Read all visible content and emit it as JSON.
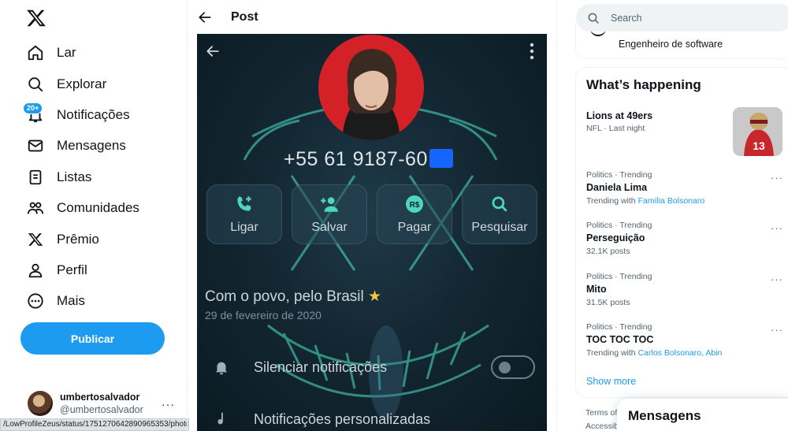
{
  "nav": {
    "items": [
      {
        "label": "Lar",
        "icon": "home-icon"
      },
      {
        "label": "Explorar",
        "icon": "search-icon"
      },
      {
        "label": "Notificações",
        "icon": "bell-icon"
      },
      {
        "label": "Mensagens",
        "icon": "envelope-icon"
      },
      {
        "label": "Listas",
        "icon": "list-icon"
      },
      {
        "label": "Comunidades",
        "icon": "communities-icon"
      },
      {
        "label": "Prêmio",
        "icon": "x-logo-icon"
      },
      {
        "label": "Perfil",
        "icon": "person-icon"
      },
      {
        "label": "Mais",
        "icon": "more-circle-icon"
      }
    ],
    "notification_badge": "20+",
    "publish_label": "Publicar"
  },
  "account": {
    "name": "umbertosalvador",
    "handle": "@umbertosalvador",
    "more": "···"
  },
  "status_url": "/LowProfileZeus/status/1751270642890965353/photo/1",
  "post": {
    "back_icon": "arrow-left-icon",
    "title": "Post",
    "photo": {
      "phone_number": "+55 61 9187-60",
      "actions": [
        {
          "label": "Ligar",
          "icon": "phone-plus-icon"
        },
        {
          "label": "Salvar",
          "icon": "person-add-icon"
        },
        {
          "label": "Pagar",
          "icon": "rs-coin-icon",
          "icon_text": "R$"
        },
        {
          "label": "Pesquisar",
          "icon": "search-icon"
        }
      ],
      "status": "Com o povo, pelo Brasil",
      "status_emoji": "★",
      "date": "29 de fevereiro de 2020",
      "settings": [
        {
          "label": "Silenciar notificações",
          "icon": "bell-icon"
        },
        {
          "label": "Notificações personalizadas",
          "icon": "music-note-icon"
        }
      ]
    }
  },
  "search": {
    "placeholder": "Search"
  },
  "profile_card": {
    "subtitle": "Engenheiro de software"
  },
  "trends": {
    "heading": "What’s happening",
    "items": [
      {
        "meta": "NFL · Last night",
        "name": "Lions at 49ers",
        "sub": ""
      },
      {
        "meta": "Politics · Trending",
        "name": "Daniela Lima",
        "sub_prefix": "Trending with ",
        "sub_links": "Família Bolsonaro"
      },
      {
        "meta": "Politics · Trending",
        "name": "Perseguição",
        "sub": "32.1K posts"
      },
      {
        "meta": "Politics · Trending",
        "name": "Mito",
        "sub": "31.5K posts"
      },
      {
        "meta": "Politics · Trending",
        "name": "TOC TOC TOC",
        "sub_prefix": "Trending with ",
        "sub_links": "Carlos Bolsonaro, Abin"
      }
    ],
    "show_more": "Show more"
  },
  "footer": {
    "line1": "Terms of",
    "line2": "Accessib"
  },
  "messages_drawer": {
    "title": "Mensagens"
  },
  "colors": {
    "accent": "#1d9bf0",
    "text": "#0f1419",
    "muted": "#536471"
  }
}
